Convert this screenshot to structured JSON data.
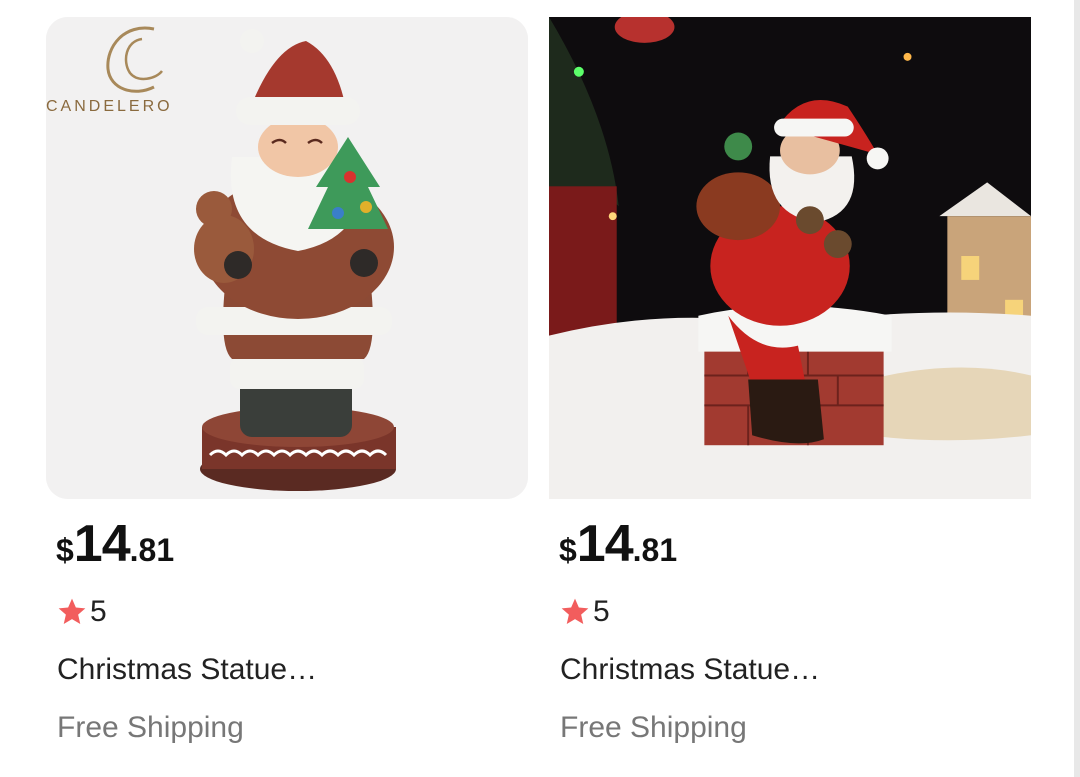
{
  "products": [
    {
      "image_alt": "Candelero Santa statue",
      "brand_logo": "CANDELERO",
      "price": {
        "currency": "$",
        "integer": "14",
        "decimal": ".81"
      },
      "rating": "5",
      "title": "Christmas Statue…",
      "shipping": "Free Shipping"
    },
    {
      "image_alt": "Santa on chimney statue",
      "price": {
        "currency": "$",
        "integer": "14",
        "decimal": ".81"
      },
      "rating": "5",
      "title": "Christmas Statue…",
      "shipping": "Free Shipping"
    }
  ],
  "colors": {
    "star": "#f25d5d",
    "price": "#111111",
    "muted": "#777777"
  },
  "icons": {
    "rating": "star-icon"
  }
}
